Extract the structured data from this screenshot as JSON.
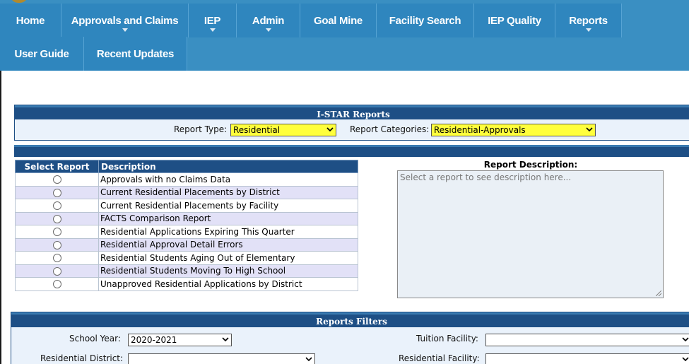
{
  "nav": {
    "row1": [
      {
        "label": "Home",
        "dropdown": false
      },
      {
        "label": "Approvals and Claims",
        "dropdown": true
      },
      {
        "label": "IEP",
        "dropdown": true
      },
      {
        "label": "Admin",
        "dropdown": true
      },
      {
        "label": "Goal Mine",
        "dropdown": false
      },
      {
        "label": "Facility Search",
        "dropdown": false
      },
      {
        "label": "IEP Quality",
        "dropdown": false
      },
      {
        "label": "Reports",
        "dropdown": true
      }
    ],
    "row2": [
      {
        "label": "User Guide",
        "dropdown": false
      },
      {
        "label": "Recent Updates",
        "dropdown": false
      }
    ]
  },
  "istar": {
    "title": "I-STAR Reports",
    "report_type_label": "Report Type:",
    "report_type_value": "Residential",
    "report_categories_label": "Report Categories:",
    "report_categories_value": "Residential-Approvals"
  },
  "reports_table": {
    "col_select": "Select Report",
    "col_description": "Description",
    "rows": [
      "Approvals with no Claims Data",
      "Current Residential Placements by District",
      "Current Residential Placements by Facility",
      "FACTS Comparison Report",
      "Residential Applications Expiring This Quarter",
      "Residential Approval Detail Errors",
      "Residential Students Aging Out of Elementary",
      "Residential Students Moving To High School",
      "Unapproved Residential Applications by District"
    ]
  },
  "report_description": {
    "title": "Report Description:",
    "placeholder": "Select a report to see description here..."
  },
  "filters": {
    "title": "Reports Filters",
    "school_year_label": "School Year:",
    "school_year_value": "2020-2021",
    "tuition_facility_label": "Tuition Facility:",
    "tuition_facility_value": "",
    "residential_district_label": "Residential District:",
    "residential_district_value": "",
    "residential_facility_label": "Residential Facility:",
    "residential_facility_value": ""
  },
  "colors": {
    "nav_bg": "#3a8fc2",
    "nav_item": "#2f86be",
    "panel_header": "#1e4f85",
    "highlight_select": "#ffff3c",
    "alt_row": "#e2e1f7"
  }
}
